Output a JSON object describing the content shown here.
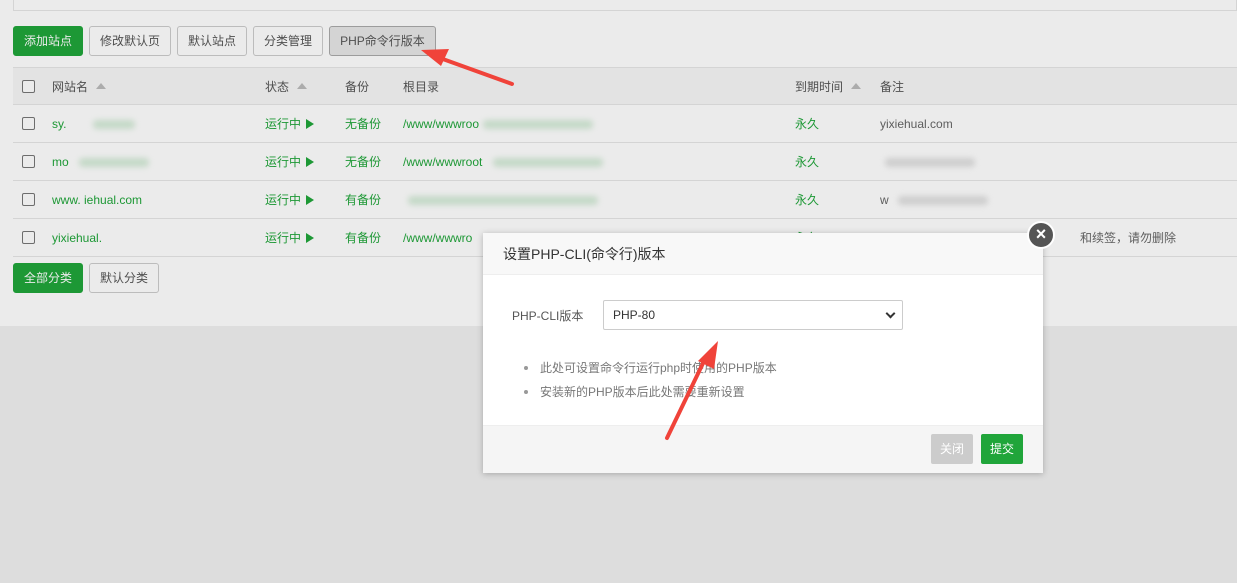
{
  "toolbar": {
    "add_site": "添加站点",
    "modify_default_page": "修改默认页",
    "default_site": "默认站点",
    "category_manage": "分类管理",
    "php_cli_version": "PHP命令行版本"
  },
  "table": {
    "headers": {
      "site_name": "网站名",
      "status": "状态",
      "backup": "备份",
      "root": "根目录",
      "expire": "到期时间",
      "note": "备注"
    },
    "rows": [
      {
        "name": "sy.",
        "status": "运行中",
        "backup": "无备份",
        "root": "/www/wwwroo",
        "expire": "永久",
        "note": "yixiehual.com"
      },
      {
        "name": "mo",
        "status": "运行中",
        "backup": "无备份",
        "root": "/www/wwwroot",
        "expire": "永久",
        "note": ""
      },
      {
        "name": "www.      iehual.com",
        "status": "运行中",
        "backup": "有备份",
        "root": "",
        "expire": "永久",
        "note": "w"
      },
      {
        "name": "yixiehual.",
        "status": "运行中",
        "backup": "有备份",
        "root": "/www/wwwro",
        "expire": "永久",
        "note": "和续签，请勿删除"
      }
    ]
  },
  "bottom": {
    "all_categories": "全部分类",
    "default_category": "默认分类"
  },
  "dialog": {
    "title": "设置PHP-CLI(命令行)版本",
    "close_glyph": "×",
    "label": "PHP-CLI版本",
    "selected": "PHP-80",
    "tips": [
      "此处可设置命令行运行php时使用的PHP版本",
      "安装新的PHP版本后此处需要重新设置"
    ],
    "close_button": "关闭",
    "submit_button": "提交"
  },
  "colors": {
    "brand_green": "#20a53a",
    "annotation_red": "#f0433a"
  }
}
